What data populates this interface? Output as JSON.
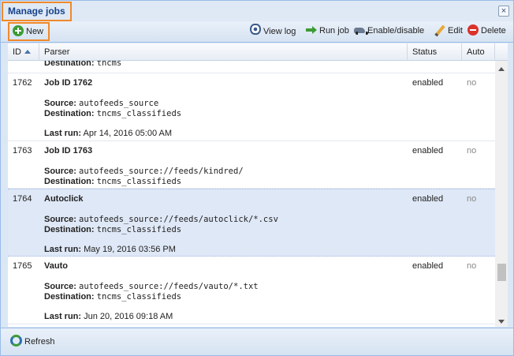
{
  "window": {
    "title": "Manage jobs",
    "close_label": "×"
  },
  "toolbar": {
    "new_label": "New",
    "view_log_label": "View log",
    "run_job_label": "Run job",
    "enable_disable_label": "Enable/disable",
    "edit_label": "Edit",
    "delete_label": "Delete"
  },
  "grid": {
    "columns": {
      "id": "ID",
      "parser": "Parser",
      "status": "Status",
      "auto": "Auto"
    },
    "labels": {
      "source": "Source:",
      "destination": "Destination:",
      "last_run": "Last run:"
    },
    "partial_top": {
      "destination": "tncms"
    },
    "rows": [
      {
        "id": "1762",
        "name": "Job ID 1762",
        "source": "autofeeds_source",
        "destination": "tncms_classifieds",
        "last_run": "Apr 14, 2016 05:00 AM",
        "status": "enabled",
        "auto": "no"
      },
      {
        "id": "1763",
        "name": "Job ID 1763",
        "source": "autofeeds_source://feeds/kindred/",
        "destination": "tncms_classifieds",
        "last_run": "",
        "status": "enabled",
        "auto": "no"
      },
      {
        "id": "1764",
        "name": "Autoclick",
        "source": "autofeeds_source://feeds/autoclick/*.csv",
        "destination": "tncms_classifieds",
        "last_run": "May 19, 2016 03:56 PM",
        "status": "enabled",
        "auto": "no"
      },
      {
        "id": "1765",
        "name": "Vauto",
        "source": "autofeeds_source://feeds/vauto/*.txt",
        "destination": "tncms_classifieds",
        "last_run": "Jun 20, 2016 09:18 AM",
        "status": "enabled",
        "auto": "no"
      }
    ]
  },
  "footer": {
    "refresh_label": "Refresh"
  }
}
